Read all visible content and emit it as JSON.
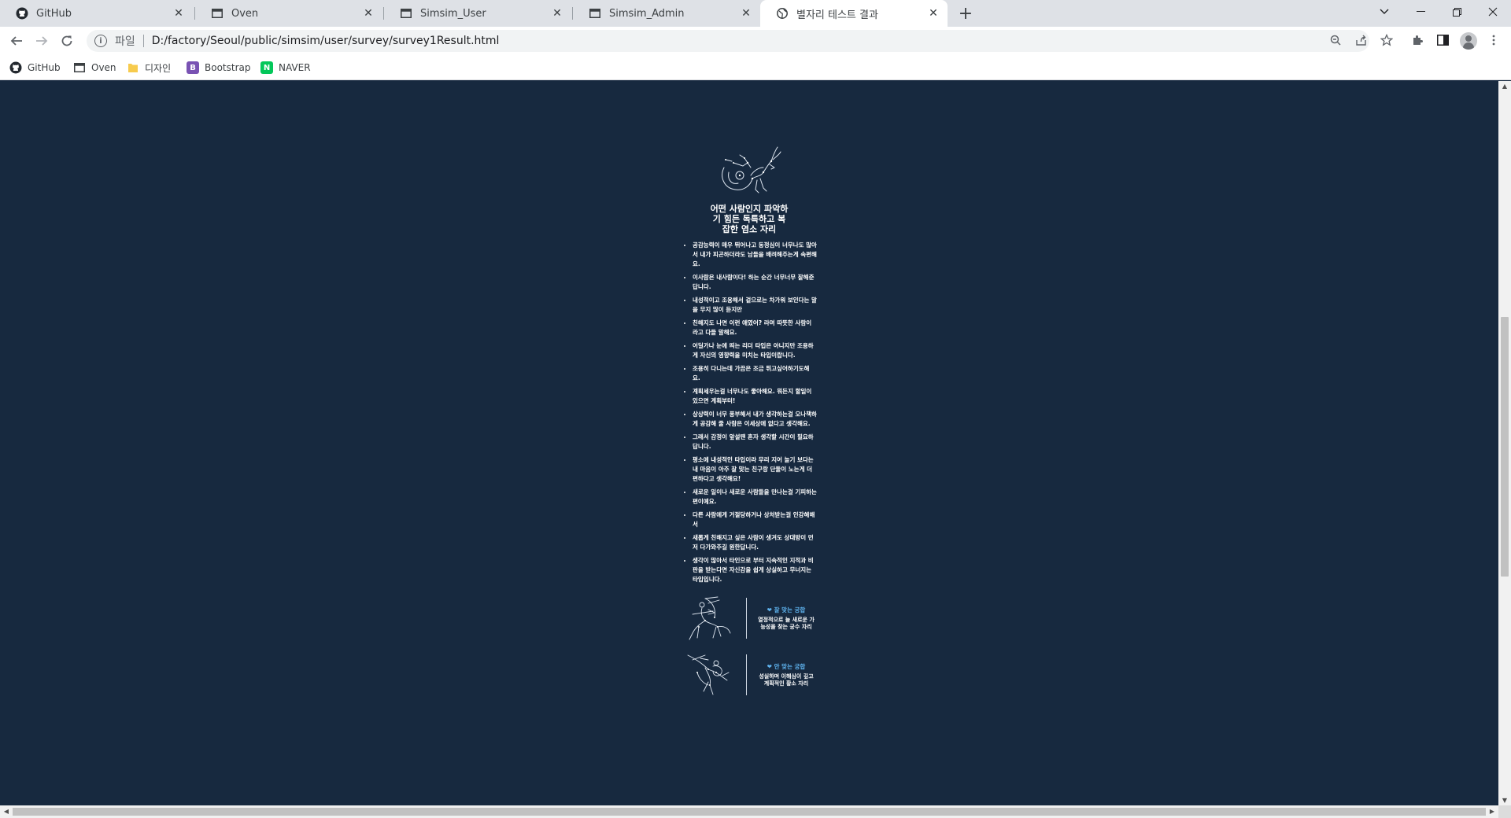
{
  "tabs": [
    {
      "title": "GitHub",
      "icon": "github-icon"
    },
    {
      "title": "Oven",
      "icon": "window-icon"
    },
    {
      "title": "Simsim_User",
      "icon": "window-icon"
    },
    {
      "title": "Simsim_Admin",
      "icon": "window-icon"
    },
    {
      "title": "별자리 테스트 결과",
      "icon": "globe-icon",
      "active": true
    }
  ],
  "address_bar": {
    "scheme_label": "파일",
    "url": "D:/factory/Seoul/public/simsim/user/survey/survey1Result.html"
  },
  "bookmarks": [
    {
      "label": "GitHub",
      "icon": "github-icon"
    },
    {
      "label": "Oven",
      "icon": "window-icon"
    },
    {
      "label": "디자인",
      "icon": "folder-icon"
    },
    {
      "label": "Bootstrap",
      "icon": "bootstrap-icon",
      "color": "#7952b3"
    },
    {
      "label": "NAVER",
      "icon": "naver-icon",
      "color": "#03c75a"
    }
  ],
  "result": {
    "title_lines": [
      "어떤 사람인지 파악하",
      "기 힘든 독특하고 복",
      "잡한 염소 자리"
    ],
    "traits": [
      "공감능력이 매우 뛰어나고 동정심이 너무나도 많아서 내가 피곤하더라도 남들을 배려해주는게 속편해요.",
      "이사람은 내사람이다! 하는 순간 너무너무 잘해준답니다.",
      "내성적이고 조용해서 겉으로는 차가워 보인다는 말을 무지 많이 듣지만",
      "친해지도 나면 이런 애였어? 라며 따뜻한 사람이라고 다들 말해요.",
      "어딜가나 눈에 띄는 리더 타입은 아니지만 조용하게 자신의 영향력을 미치는 타입이랍니다.",
      "조용히 다니는데 가끔은 조금 튀고싶어하기도해요.",
      "계획세우는걸 너무나도 좋아해요. 뭐든지 할일이 있으면 계획부터!",
      "상상력이 너무 풍부해서 내가 생각하는걸 오나책하게 공감해 줄 사람은 이세상에 없다고 생각해요.",
      "그래서 감정이 앞설땐 혼자 생각할 시간이 필요하답니다.",
      "평소에 내성적인 타입이라 무리 지어 놀기 보다는 내 마음이 아주 잘 맞는 친구랑 단둘이 노는게 더 편하다고 생각해요!",
      "새로운 일이나 새로운 사람들을 만나는걸 기피하는 편이예요.",
      "다른 사람에게 거절당하거나 상처받는걸 인강해해서",
      "새롭게 친해지고 싶은 사람이 생겨도 상대방이 먼저 다가와주길 원한답니다.",
      "생각이 많아서 타인으로 부터 지속적인 지적과 비판을 받는다면 자신감을 쉽게 상실하고 무너지는 타입입니다."
    ],
    "good_match": {
      "heading": "잘 맞는 궁합",
      "description": "열정적으로 늘 새로운 가능성을 찾는 궁수 자리",
      "icon": "sagittarius-archer-icon"
    },
    "bad_match": {
      "heading": "안 맞는 궁합",
      "description": "성실하며 이해심이 깊고 계획적인 황소 자리",
      "icon": "cupid-archer-icon"
    },
    "hero_icon": "capricorn-goat-icon"
  },
  "colors": {
    "page_background": "#17293f",
    "text": "#ffffff",
    "match_heading": "#5fb4f0"
  }
}
